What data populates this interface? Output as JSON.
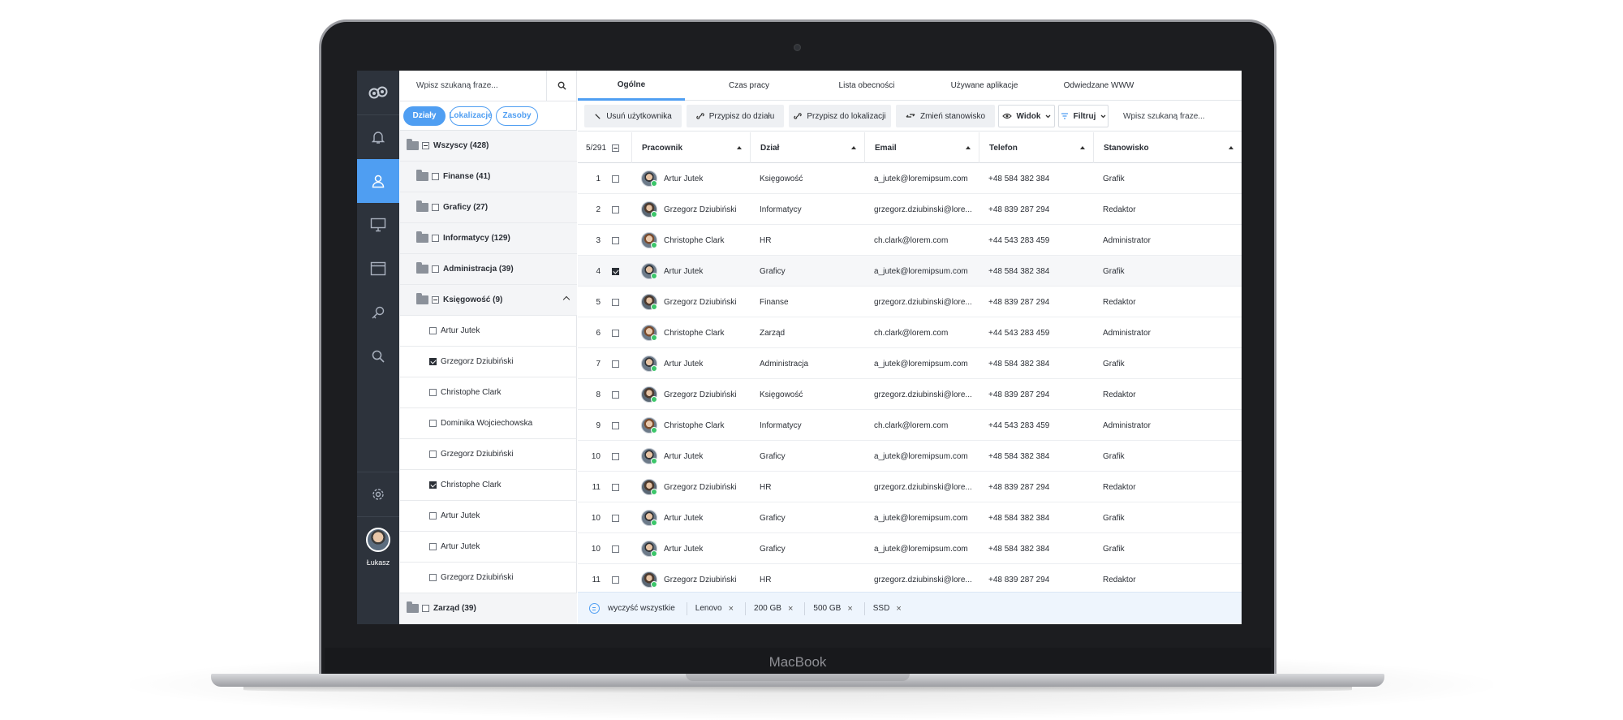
{
  "device": {
    "brand": "MacBook"
  },
  "rail": {
    "user_name": "Łukasz"
  },
  "panel": {
    "search_placeholder": "Wpisz szukaną fraze...",
    "filters": [
      "Działy",
      "Lokalizacje",
      "Zasoby"
    ],
    "tree": [
      {
        "label": "Wszyscy (428)",
        "level": 0,
        "folder": true,
        "check": "minus",
        "bold": true
      },
      {
        "label": "Finanse (41)",
        "level": 1,
        "folder": true,
        "check": "none",
        "bold": true
      },
      {
        "label": "Graficy (27)",
        "level": 1,
        "folder": true,
        "check": "none",
        "bold": true
      },
      {
        "label": "Informatycy (129)",
        "level": 1,
        "folder": true,
        "check": "none",
        "bold": true
      },
      {
        "label": "Administracja (39)",
        "level": 1,
        "folder": true,
        "check": "none",
        "bold": true
      },
      {
        "label": "Księgowość (9)",
        "level": 1,
        "folder": true,
        "check": "minus",
        "bold": true,
        "expanded": true
      },
      {
        "label": "Artur Jutek",
        "level": 2,
        "folder": false,
        "check": "none",
        "bold": false
      },
      {
        "label": "Grzegorz Dziubiński",
        "level": 2,
        "folder": false,
        "check": "checked",
        "bold": false
      },
      {
        "label": "Christophe Clark",
        "level": 2,
        "folder": false,
        "check": "none",
        "bold": false
      },
      {
        "label": "Dominika Wojciechowska",
        "level": 2,
        "folder": false,
        "check": "none",
        "bold": false
      },
      {
        "label": "Grzegorz Dziubiński",
        "level": 2,
        "folder": false,
        "check": "none",
        "bold": false
      },
      {
        "label": "Christophe Clark",
        "level": 2,
        "folder": false,
        "check": "checked",
        "bold": false
      },
      {
        "label": "Artur Jutek",
        "level": 2,
        "folder": false,
        "check": "none",
        "bold": false
      },
      {
        "label": "Artur Jutek",
        "level": 2,
        "folder": false,
        "check": "none",
        "bold": false
      },
      {
        "label": "Grzegorz Dziubiński",
        "level": 2,
        "folder": false,
        "check": "none",
        "bold": false
      },
      {
        "label": "Zarząd (39)",
        "level": 0,
        "folder": true,
        "check": "none",
        "bold": true
      }
    ]
  },
  "tabs": [
    "Ogólne",
    "Czas pracy",
    "Lista obecności",
    "Używane aplikacje",
    "Odwiedzane WWW"
  ],
  "toolbar": {
    "remove_user": "Usuń użytkownika",
    "assign_dept": "Przypisz do działu",
    "assign_location": "Przypisz do lokalizacji",
    "change_position": "Zmień stanowisko",
    "view": "Widok",
    "filter": "Filtruj",
    "search_placeholder": "Wpisz szukaną fraze..."
  },
  "table": {
    "count": "5/291",
    "columns": [
      "Pracownik",
      "Dział",
      "Email",
      "Telefon",
      "Stanowisko"
    ],
    "rows": [
      {
        "n": "1",
        "checked": false,
        "name": "Artur Jutek",
        "dept": "Księgowość",
        "email": "a_jutek@loremipsum.com",
        "phone": "+48 584 382 384",
        "pos": "Grafik",
        "av": "m"
      },
      {
        "n": "2",
        "checked": false,
        "name": "Grzegorz Dziubiński",
        "dept": "Informatycy",
        "email": "grzegorz.dziubinski@lore...",
        "phone": "+48 839 287 294",
        "pos": "Redaktor",
        "av": "b"
      },
      {
        "n": "3",
        "checked": false,
        "name": "Christophe Clark",
        "dept": "HR",
        "email": "ch.clark@lorem.com",
        "phone": "+44 543 283 459",
        "pos": "Administrator",
        "av": "f"
      },
      {
        "n": "4",
        "checked": true,
        "name": "Artur Jutek",
        "dept": "Graficy",
        "email": "a_jutek@loremipsum.com",
        "phone": "+48 584 382 384",
        "pos": "Grafik",
        "av": "m"
      },
      {
        "n": "5",
        "checked": false,
        "name": "Grzegorz Dziubiński",
        "dept": "Finanse",
        "email": "grzegorz.dziubinski@lore...",
        "phone": "+48 839 287 294",
        "pos": "Redaktor",
        "av": "b"
      },
      {
        "n": "6",
        "checked": false,
        "name": "Christophe Clark",
        "dept": "Zarząd",
        "email": "ch.clark@lorem.com",
        "phone": "+44 543 283 459",
        "pos": "Administrator",
        "av": "f"
      },
      {
        "n": "7",
        "checked": false,
        "name": "Artur Jutek",
        "dept": "Administracja",
        "email": "a_jutek@loremipsum.com",
        "phone": "+48 584 382 384",
        "pos": "Grafik",
        "av": "m"
      },
      {
        "n": "8",
        "checked": false,
        "name": "Grzegorz Dziubiński",
        "dept": "Księgowość",
        "email": "grzegorz.dziubinski@lore...",
        "phone": "+48 839 287 294",
        "pos": "Redaktor",
        "av": "b"
      },
      {
        "n": "9",
        "checked": false,
        "name": "Christophe Clark",
        "dept": "Informatycy",
        "email": "ch.clark@lorem.com",
        "phone": "+44 543 283 459",
        "pos": "Administrator",
        "av": "f"
      },
      {
        "n": "10",
        "checked": false,
        "name": "Artur Jutek",
        "dept": "Graficy",
        "email": "a_jutek@loremipsum.com",
        "phone": "+48 584 382 384",
        "pos": "Grafik",
        "av": "m"
      },
      {
        "n": "11",
        "checked": false,
        "name": "Grzegorz Dziubiński",
        "dept": "HR",
        "email": "grzegorz.dziubinski@lore...",
        "phone": "+48 839 287 294",
        "pos": "Redaktor",
        "av": "b"
      },
      {
        "n": "10",
        "checked": false,
        "name": "Artur Jutek",
        "dept": "Graficy",
        "email": "a_jutek@loremipsum.com",
        "phone": "+48 584 382 384",
        "pos": "Grafik",
        "av": "m"
      },
      {
        "n": "10",
        "checked": false,
        "name": "Artur Jutek",
        "dept": "Graficy",
        "email": "a_jutek@loremipsum.com",
        "phone": "+48 584 382 384",
        "pos": "Grafik",
        "av": "m"
      },
      {
        "n": "11",
        "checked": false,
        "name": "Grzegorz Dziubiński",
        "dept": "HR",
        "email": "grzegorz.dziubinski@lore...",
        "phone": "+48 839 287 294",
        "pos": "Redaktor",
        "av": "b"
      }
    ]
  },
  "footer": {
    "clear_all": "wyczyść wszystkie",
    "chips": [
      "Lenovo",
      "200 GB",
      "500 GB",
      "SSD"
    ]
  },
  "colors": {
    "accent": "#4f9ef2",
    "rail": "#2d333c"
  }
}
